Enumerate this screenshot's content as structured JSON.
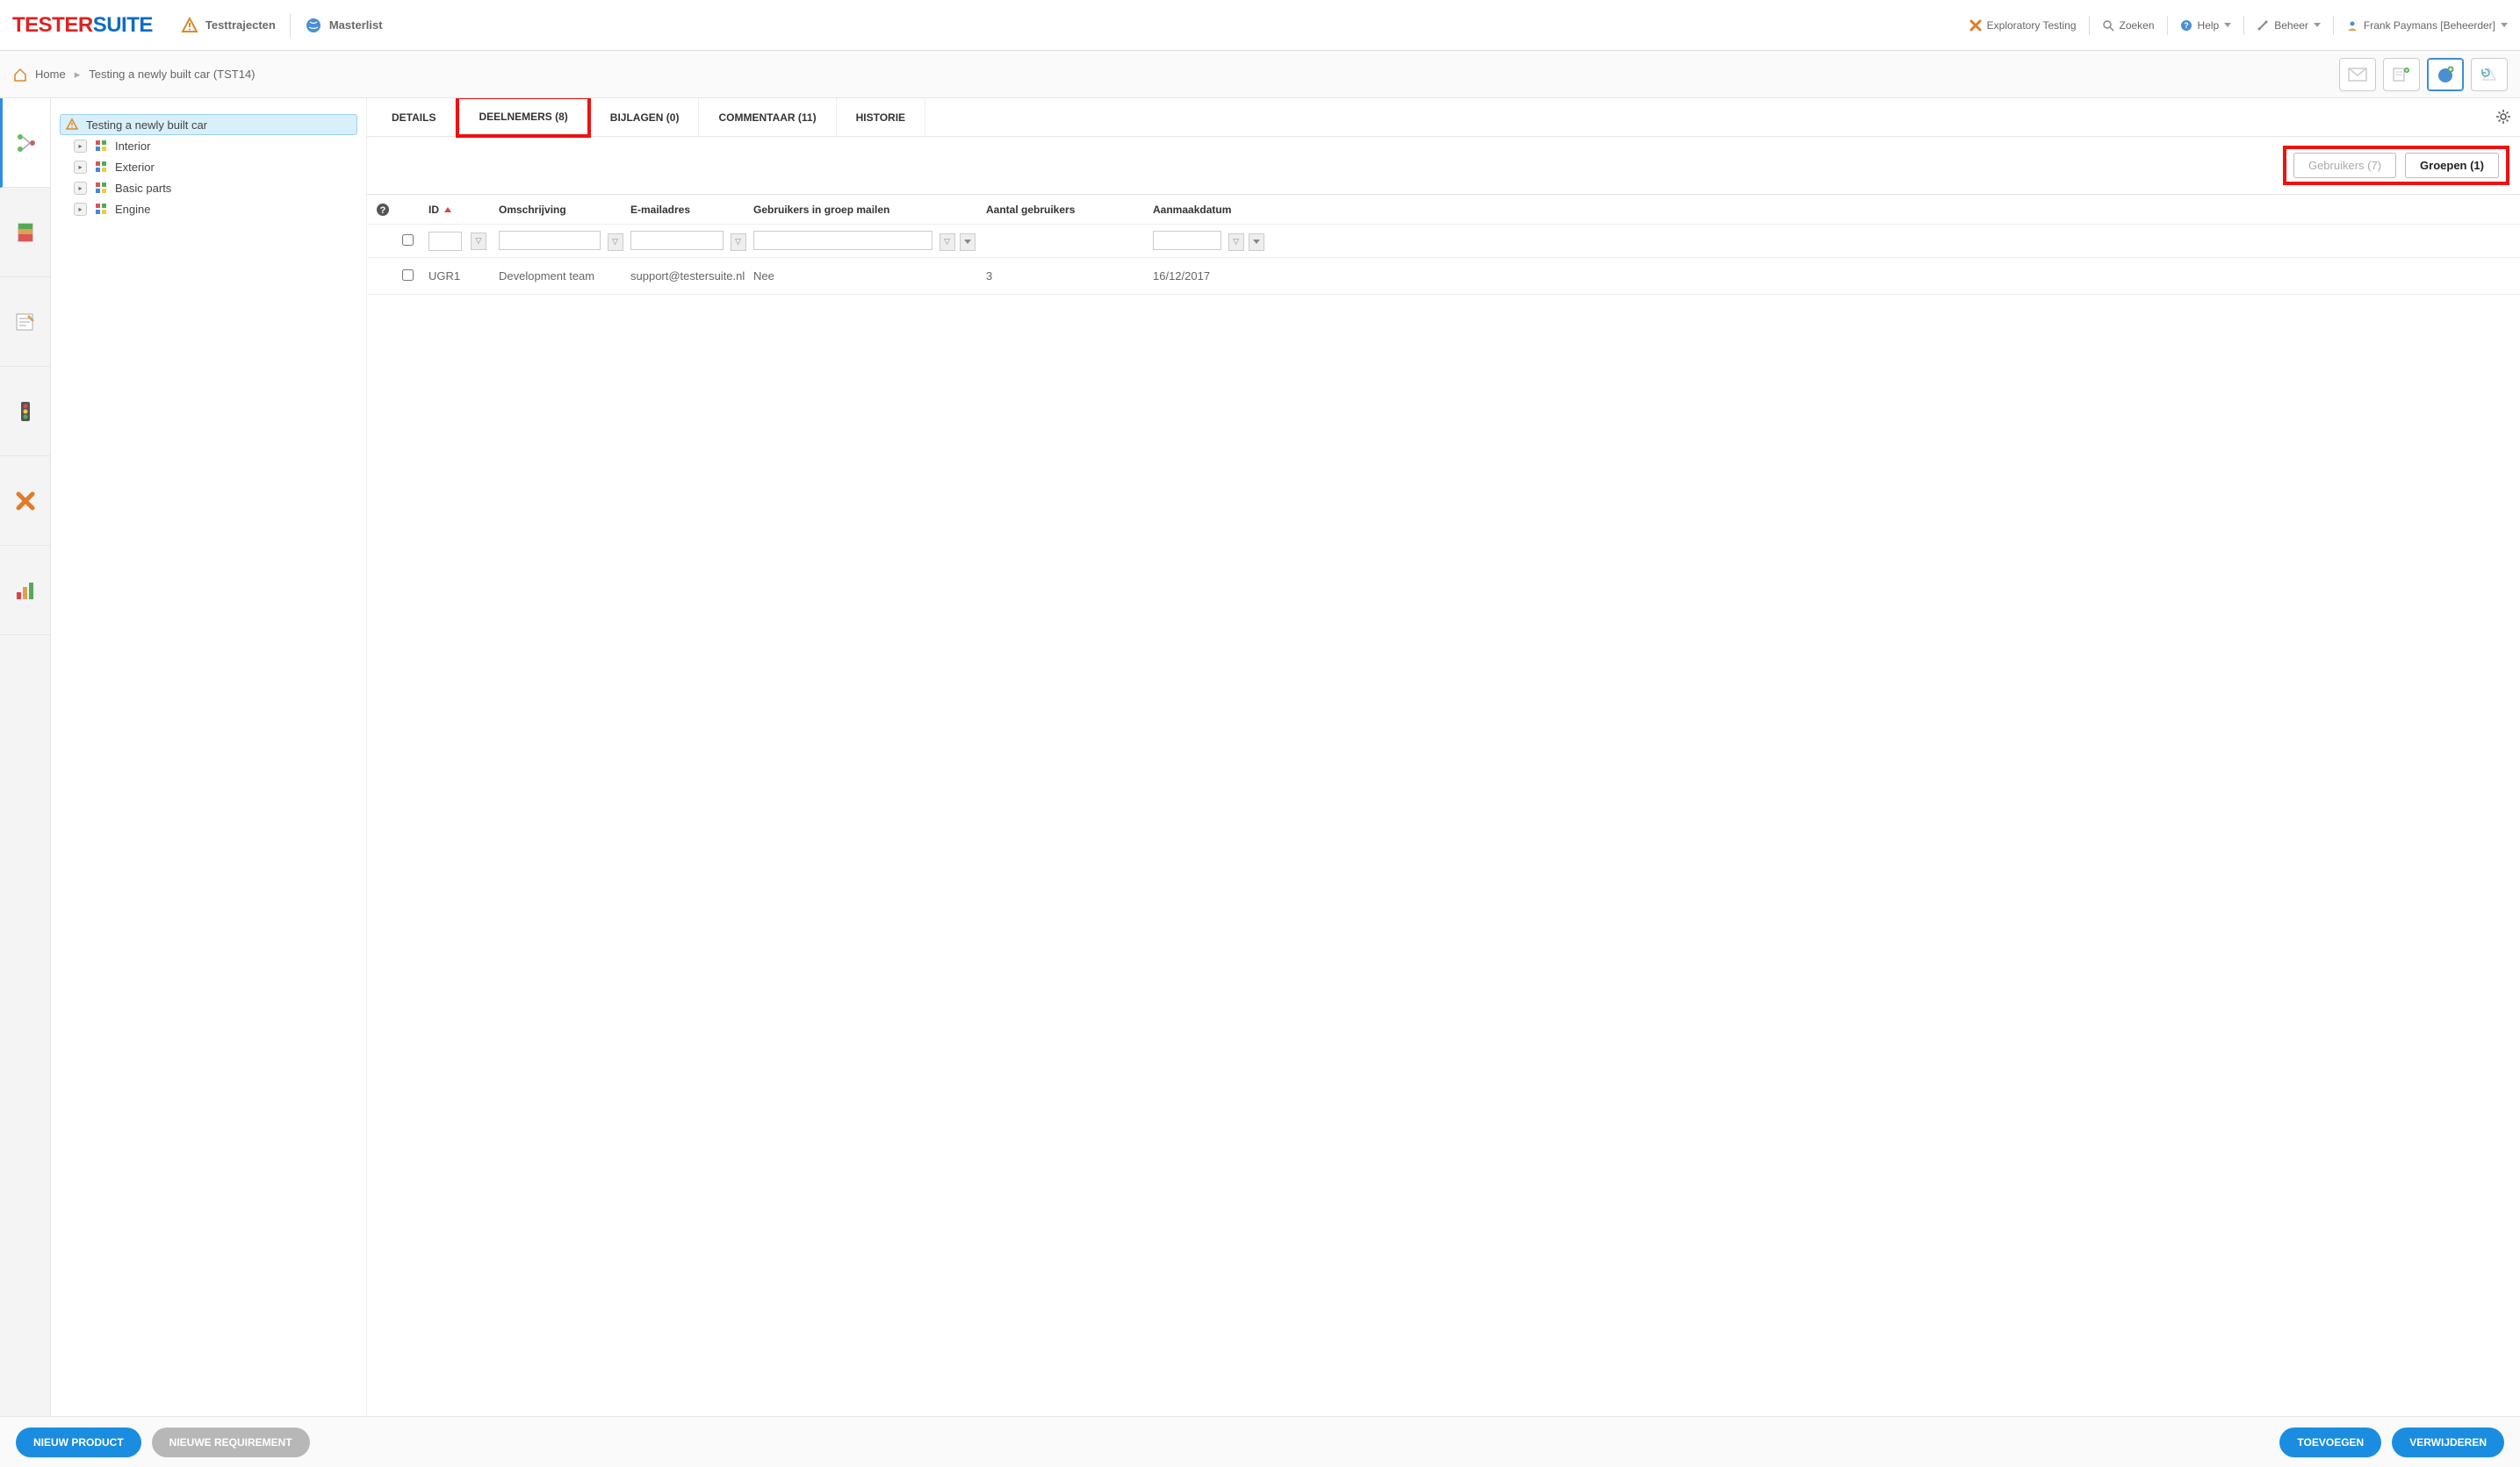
{
  "logo": {
    "part1": "TESTER",
    "part2": "SUITE"
  },
  "topnav": {
    "testtrajecten": "Testtrajecten",
    "masterlist": "Masterlist"
  },
  "topright": {
    "exploratory": "Exploratory Testing",
    "zoeken": "Zoeken",
    "help": "Help",
    "beheer": "Beheer",
    "user": "Frank Paymans [Beheerder]"
  },
  "breadcrumb": {
    "home": "Home",
    "current": "Testing a newly built car (TST14)"
  },
  "tree": {
    "root": "Testing a newly built car",
    "children": [
      "Interior",
      "Exterior",
      "Basic parts",
      "Engine"
    ]
  },
  "tabs": {
    "details": "DETAILS",
    "deelnemers": "DEELNEMERS (8)",
    "bijlagen": "BIJLAGEN (0)",
    "commentaar": "COMMENTAAR (11)",
    "historie": "HISTORIE"
  },
  "subtabs": {
    "gebruikers": "Gebruikers (7)",
    "groepen": "Groepen (1)"
  },
  "grid": {
    "headers": {
      "id": "ID",
      "omschrijving": "Omschrijving",
      "email": "E-mailadres",
      "mailgroup": "Gebruikers in groep mailen",
      "count": "Aantal gebruikers",
      "date": "Aanmaakdatum"
    },
    "rows": [
      {
        "id": "UGR1",
        "desc": "Development team",
        "email": "support@testersuite.nl",
        "mailgroup": "Nee",
        "count": "3",
        "date": "16/12/2017"
      }
    ]
  },
  "footer": {
    "nieuw_product": "NIEUW PRODUCT",
    "nieuwe_requirement": "NIEUWE REQUIREMENT",
    "toevoegen": "TOEVOEGEN",
    "verwijderen": "VERWIJDEREN"
  }
}
